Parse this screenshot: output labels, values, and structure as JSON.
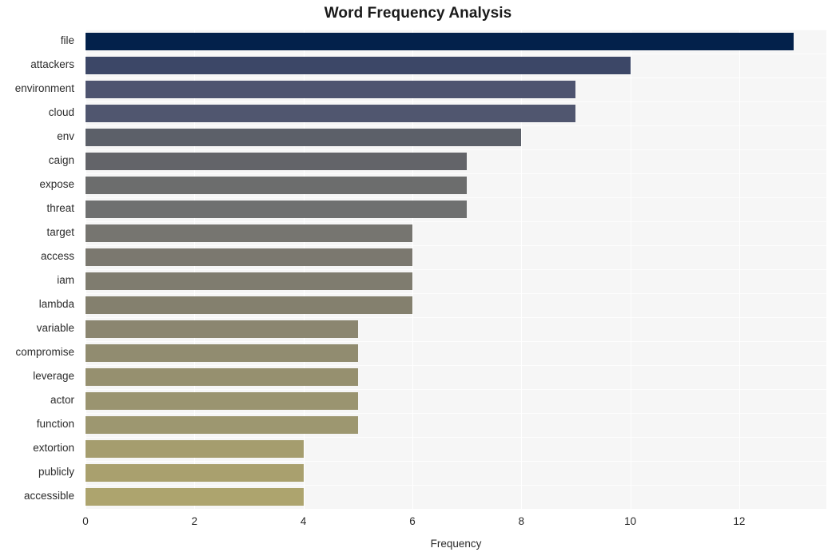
{
  "chart_data": {
    "type": "bar",
    "orientation": "horizontal",
    "title": "Word Frequency Analysis",
    "xlabel": "Frequency",
    "ylabel": "",
    "categories": [
      "file",
      "attackers",
      "environment",
      "cloud",
      "env",
      "caign",
      "expose",
      "threat",
      "target",
      "access",
      "iam",
      "lambda",
      "variable",
      "compromise",
      "leverage",
      "actor",
      "function",
      "extortion",
      "publicly",
      "accessible"
    ],
    "values": [
      13,
      10,
      9,
      9,
      8,
      7,
      7,
      7,
      6,
      6,
      6,
      6,
      5,
      5,
      5,
      5,
      5,
      4,
      4,
      4
    ],
    "xticks": [
      0,
      2,
      4,
      6,
      8,
      10,
      12
    ],
    "xtick_labels": [
      "0",
      "2",
      "4",
      "6",
      "8",
      "10",
      "12"
    ],
    "xlim": [
      0,
      13.6
    ],
    "grid": true,
    "grid_color": "#ffffff",
    "legend": null,
    "plot_background": "#f6f6f6",
    "figure_background": "#ffffff",
    "bar_colors": [
      "#03214b",
      "#3c4767",
      "#4e5470",
      "#50566f",
      "#5c6069",
      "#636469",
      "#6c6d6d",
      "#6f7070",
      "#767570",
      "#7b786f",
      "#7f7c6f",
      "#84806e",
      "#8b8670",
      "#918c70",
      "#96906f",
      "#9a9470",
      "#9d9770",
      "#a59d6e",
      "#a9a06e",
      "#ada46e"
    ]
  }
}
